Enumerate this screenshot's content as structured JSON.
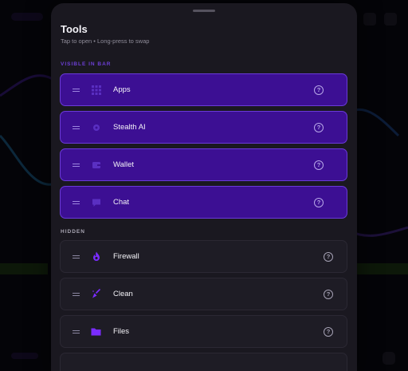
{
  "sheet": {
    "title": "Tools",
    "subtitle": "Tap to open • Long-press to swap"
  },
  "sections": {
    "visible_label": "VISIBLE IN BAR",
    "hidden_label": "HIDDEN"
  },
  "visible_tools": [
    {
      "label": "Apps",
      "icon": "grid-icon"
    },
    {
      "label": "Stealth AI",
      "icon": "spark-icon"
    },
    {
      "label": "Wallet",
      "icon": "wallet-icon"
    },
    {
      "label": "Chat",
      "icon": "chat-icon"
    }
  ],
  "hidden_tools": [
    {
      "label": "Firewall",
      "icon": "flame-icon"
    },
    {
      "label": "Clean",
      "icon": "broom-icon"
    },
    {
      "label": "Files",
      "icon": "folder-icon"
    }
  ],
  "help_glyph": "?",
  "colors": {
    "accent": "#6a3ad8",
    "active_row": "#3c0f93",
    "sheet_bg": "#1a1820",
    "inactive_row": "#1e1c25",
    "icon_purple": "#7a2cff"
  }
}
